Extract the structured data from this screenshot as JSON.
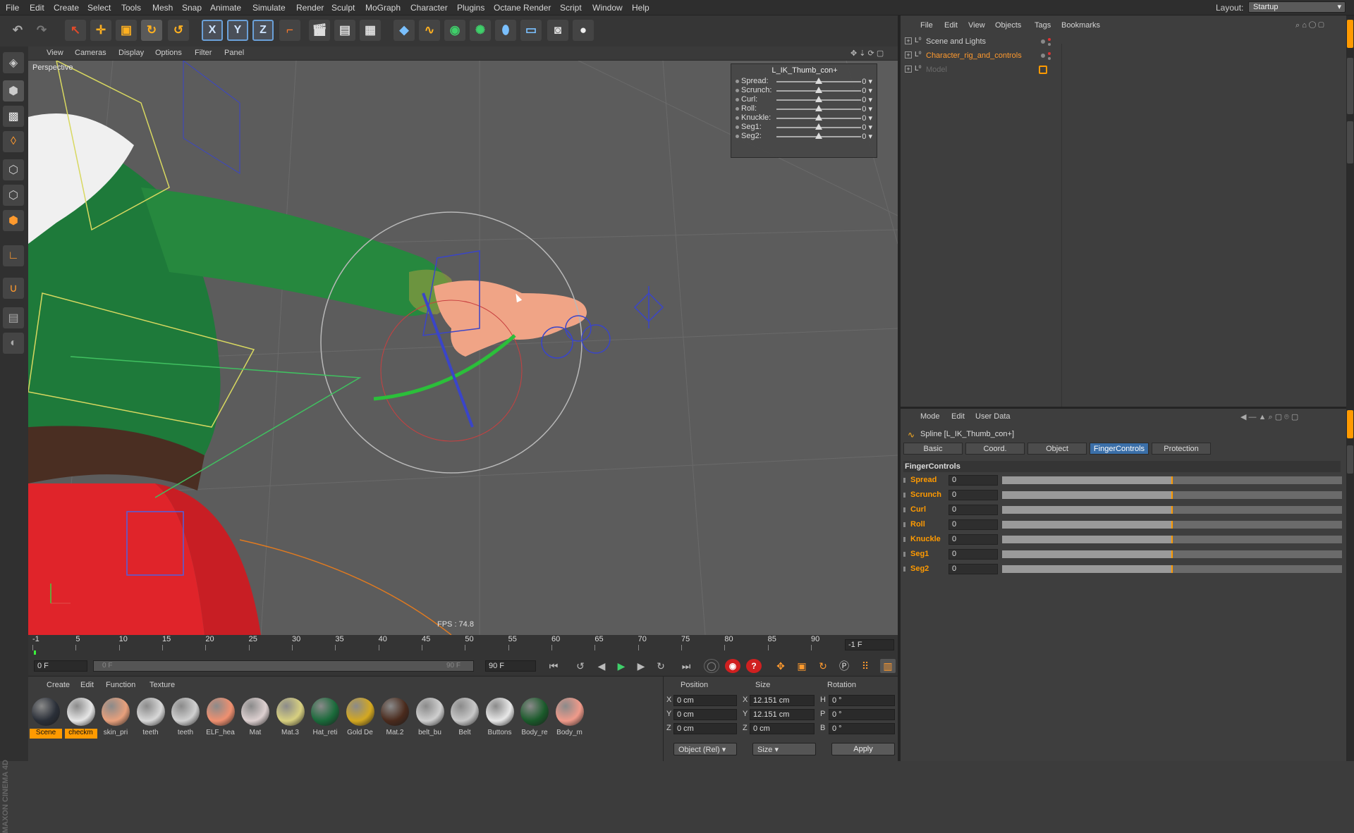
{
  "menubar": {
    "items": [
      "File",
      "Edit",
      "Create",
      "Select",
      "Tools",
      "Mesh",
      "Snap",
      "Animate",
      "Simulate",
      "Render",
      "Sculpt",
      "MoGraph",
      "Character",
      "Plugins",
      "Octane Render",
      "Script",
      "Window",
      "Help"
    ],
    "layout_label": "Layout:",
    "layout_value": "Startup"
  },
  "viewport": {
    "menu": [
      "View",
      "Cameras",
      "Display",
      "Options",
      "Filter",
      "Panel"
    ],
    "camera_label": "Perspective",
    "fps": "FPS : 74.8"
  },
  "hud": {
    "title": "L_IK_Thumb_con+",
    "sliders": [
      {
        "label": "Spread:",
        "value": "0",
        "pos": 0.5
      },
      {
        "label": "Scrunch:",
        "value": "0",
        "pos": 0.5
      },
      {
        "label": "Curl:",
        "value": "0",
        "pos": 0.5
      },
      {
        "label": "Roll:",
        "value": "0",
        "pos": 0.5
      },
      {
        "label": "Knuckle:",
        "value": "0",
        "pos": 0.5
      },
      {
        "label": "Seg1:",
        "value": "0",
        "pos": 0.5
      },
      {
        "label": "Seg2:",
        "value": "0",
        "pos": 0.5
      }
    ]
  },
  "timeline": {
    "ticks": [
      "-1",
      "5",
      "10",
      "15",
      "20",
      "25",
      "30",
      "35",
      "40",
      "45",
      "50",
      "55",
      "60",
      "65",
      "70",
      "75",
      "80",
      "85",
      "90"
    ],
    "current_frame_display": "-1 F"
  },
  "transport": {
    "start": "0 F",
    "range_start": "0 F",
    "range_end": "90 F",
    "end": "90 F"
  },
  "material_manager": {
    "menu": [
      "Create",
      "Edit",
      "Function",
      "Texture"
    ],
    "materials": [
      {
        "name": "Scene",
        "color": "#2a2f38",
        "selected": true
      },
      {
        "name": "checkm",
        "color": "#e6e6e6",
        "selected": true
      },
      {
        "name": "skin_pri",
        "color": "#e8a07c",
        "selected": false
      },
      {
        "name": "teeth",
        "color": "#d8d8d8",
        "selected": false
      },
      {
        "name": "teeth",
        "color": "#d0d0d0",
        "selected": false
      },
      {
        "name": "ELF_hea",
        "color": "#f09070",
        "selected": false
      },
      {
        "name": "Mat",
        "color": "#ddd0d0",
        "selected": false
      },
      {
        "name": "Mat.3",
        "color": "#d8d080",
        "selected": false
      },
      {
        "name": "Hat_reti",
        "color": "#1a6a3a",
        "selected": false
      },
      {
        "name": "Gold De",
        "color": "#d4a820",
        "selected": false
      },
      {
        "name": "Mat.2",
        "color": "#4a2a1c",
        "selected": false
      },
      {
        "name": "belt_bu",
        "color": "#cfcfcf",
        "selected": false
      },
      {
        "name": "Belt",
        "color": "#c8c8c8",
        "selected": false
      },
      {
        "name": "Buttons",
        "color": "#e8e8e8",
        "selected": false
      },
      {
        "name": "Body_re",
        "color": "#1a5a2a",
        "selected": false
      },
      {
        "name": "Body_m",
        "color": "#f09a8a",
        "selected": false
      }
    ]
  },
  "coordinates": {
    "headers": {
      "position": "Position",
      "size": "Size",
      "rotation": "Rotation"
    },
    "rows": [
      {
        "axis": "X",
        "pos": "0 cm",
        "size_axis": "X",
        "size": "12.151 cm",
        "rot_axis": "H",
        "rot": "0 °"
      },
      {
        "axis": "Y",
        "pos": "0 cm",
        "size_axis": "Y",
        "size": "12.151 cm",
        "rot_axis": "P",
        "rot": "0 °"
      },
      {
        "axis": "Z",
        "pos": "0 cm",
        "size_axis": "Z",
        "size": "0 cm",
        "rot_axis": "B",
        "rot": "0 °"
      }
    ],
    "mode_dropdown": "Object (Rel)",
    "size_dropdown": "Size",
    "apply": "Apply"
  },
  "object_manager": {
    "menu": [
      "File",
      "Edit",
      "View",
      "Objects",
      "Tags",
      "Bookmarks"
    ],
    "objects": [
      {
        "name": "Scene and Lights",
        "color": "#d0d0d0"
      },
      {
        "name": "Character_rig_and_controls",
        "color": "#ff9a2e"
      },
      {
        "name": "Model",
        "color": "#6a6a6a"
      }
    ]
  },
  "attributes": {
    "menu": [
      "Mode",
      "Edit",
      "User Data"
    ],
    "title": "Spline [L_IK_Thumb_con+]",
    "tabs": [
      "Basic",
      "Coord.",
      "Object",
      "FingerControls",
      "Protection"
    ],
    "active_tab": "FingerControls",
    "group": "FingerControls",
    "rows": [
      {
        "name": "Spread",
        "value": "0",
        "level": 0.5
      },
      {
        "name": "Scrunch",
        "value": "0",
        "level": 0.5
      },
      {
        "name": "Curl",
        "value": "0",
        "level": 0.5
      },
      {
        "name": "Roll",
        "value": "0",
        "level": 0.5
      },
      {
        "name": "Knuckle",
        "value": "0",
        "level": 0.5
      },
      {
        "name": "Seg1",
        "value": "0",
        "level": 0.5
      },
      {
        "name": "Seg2",
        "value": "0",
        "level": 0.5
      }
    ]
  },
  "branding": "MAXON CINEMA 4D",
  "colors": {
    "accent": "#ff9a00",
    "active_tab": "#3b6fa8"
  }
}
